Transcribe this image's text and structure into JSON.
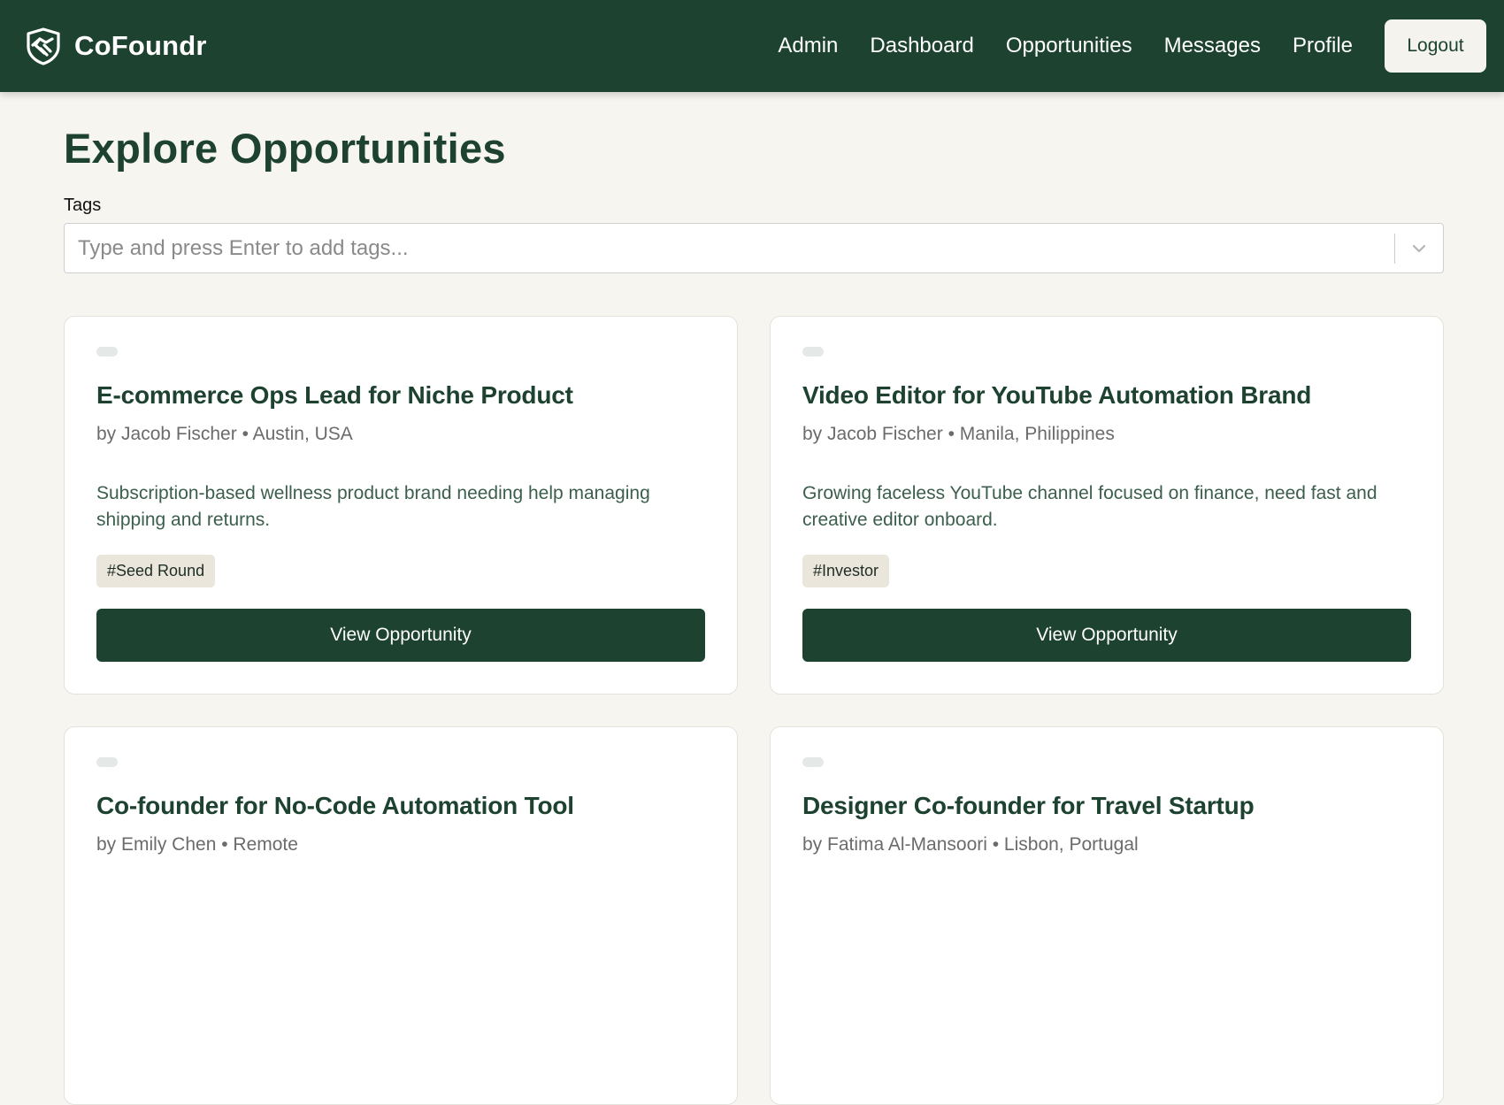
{
  "header": {
    "brand_name": "CoFoundr",
    "brand_icon": "handshake-icon",
    "nav": [
      {
        "label": "Admin"
      },
      {
        "label": "Dashboard"
      },
      {
        "label": "Opportunities"
      },
      {
        "label": "Messages"
      },
      {
        "label": "Profile"
      }
    ],
    "logout_label": "Logout"
  },
  "main": {
    "title": "Explore Opportunities",
    "tags_label": "Tags",
    "tags_placeholder": "Type and press Enter to add tags...",
    "cards": [
      {
        "title": "E-commerce Ops Lead for Niche Product",
        "meta": "by Jacob Fischer • Austin, USA",
        "description": "Subscription-based wellness product brand needing help managing shipping and returns.",
        "tag": "#Seed Round",
        "button_label": "View Opportunity"
      },
      {
        "title": "Video Editor for YouTube Automation Brand",
        "meta": "by Jacob Fischer • Manila, Philippines",
        "description": "Growing faceless YouTube channel focused on finance, need fast and creative editor onboard.",
        "tag": "#Investor",
        "button_label": "View Opportunity"
      },
      {
        "title": "Co-founder for No-Code Automation Tool",
        "meta": "by Emily Chen • Remote"
      },
      {
        "title": "Designer Co-founder for Travel Startup",
        "meta": "by Fatima Al-Mansoori • Lisbon, Portugal"
      }
    ]
  },
  "colors": {
    "primary": "#1d4230",
    "background": "#f7f5f0",
    "chip": "#ebe6dc"
  }
}
